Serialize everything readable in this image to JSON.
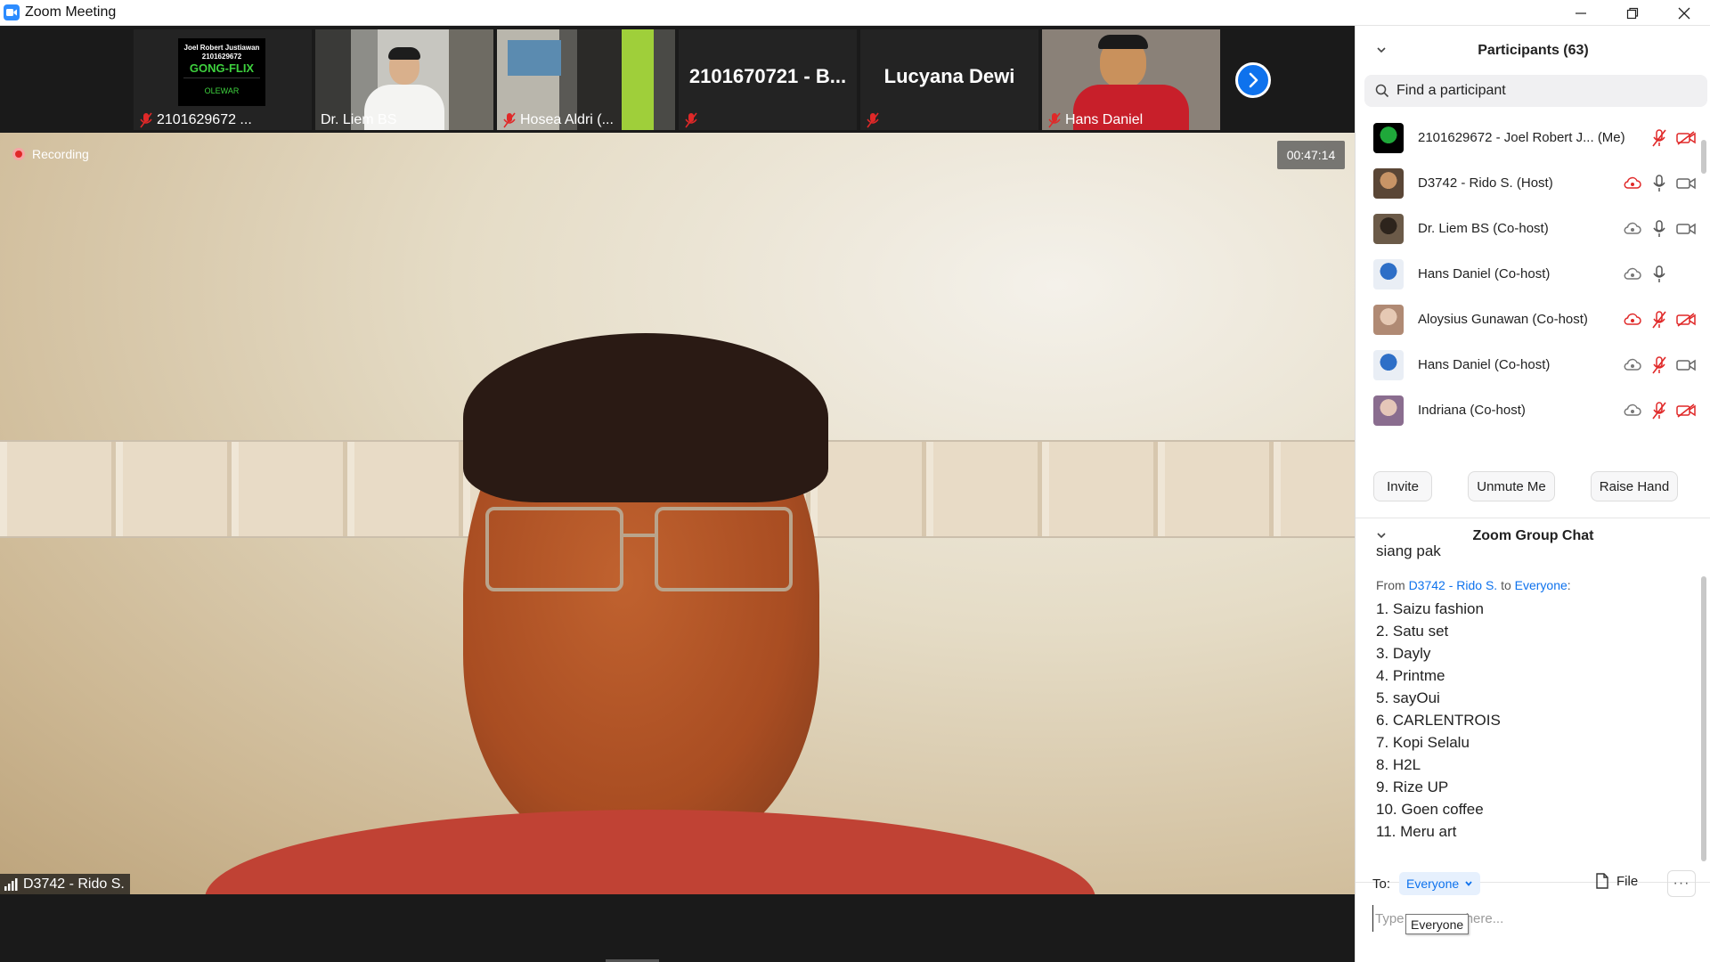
{
  "window": {
    "title": "Zoom Meeting"
  },
  "strip": {
    "tiles": [
      {
        "name": "2101629672 ...",
        "logo_lines": [
          "Joel Robert Justiawan",
          "2101629672",
          "GONG-FLIX",
          "OLEWAR"
        ]
      },
      {
        "name": "Dr. Liem BS"
      },
      {
        "name": "Hosea Aldri (..."
      },
      {
        "name": "2101670721 - B..."
      },
      {
        "name": "Lucyana Dewi"
      },
      {
        "name": "Hans Daniel"
      }
    ]
  },
  "main": {
    "recording_label": "Recording",
    "timer": "00:47:14",
    "speaker": "D3742 - Rido S."
  },
  "participants": {
    "header": "Participants (63)",
    "search_placeholder": "Find a participant",
    "rows": [
      {
        "name": "2101629672 - Joel Robert J...",
        "suffix": "(Me)",
        "rec": false,
        "mic": "muted",
        "video": "off"
      },
      {
        "name": "D3742 - Rido S. (Host)",
        "suffix": "",
        "rec": true,
        "mic": "on",
        "video": "on"
      },
      {
        "name": "Dr. Liem BS (Co-host)",
        "suffix": "",
        "rec": false,
        "mic": "on",
        "video": "on"
      },
      {
        "name": "Hans Daniel (Co-host)",
        "suffix": "",
        "rec": false,
        "mic": "on",
        "video": "none"
      },
      {
        "name": "Aloysius Gunawan (Co-host)",
        "suffix": "",
        "rec": true,
        "mic": "muted",
        "video": "off"
      },
      {
        "name": "Hans Daniel (Co-host)",
        "suffix": "",
        "rec": false,
        "mic": "muted",
        "video": "on"
      },
      {
        "name": "Indriana (Co-host)",
        "suffix": "",
        "rec": false,
        "mic": "muted",
        "video": "off"
      }
    ],
    "buttons": {
      "invite": "Invite",
      "unmute": "Unmute Me",
      "raise_hand": "Raise Hand"
    }
  },
  "chat": {
    "header": "Zoom Group Chat",
    "prev_message": "siang pak",
    "from_prefix": "From",
    "from_sender": "D3742 - Rido S.",
    "from_to": "to",
    "from_recipient": "Everyone",
    "from_suffix": ":",
    "lines": [
      "1. Saizu fashion",
      "2. Satu set",
      "3. Dayly",
      "4. Printme",
      "5. sayOui",
      "6. CARLENTROIS",
      "7. Kopi Selalu",
      "8. H2L",
      "9. Rize UP",
      "10. Goen coffee",
      "11. Meru art"
    ],
    "to_label": "To:",
    "to_value": "Everyone",
    "file_label": "File",
    "more_label": "···",
    "input_placeholder": "Type message here...",
    "tooltip": "Everyone"
  },
  "colors": {
    "accent": "#0e72ed",
    "danger": "#e02828",
    "dark_bg": "#1a1a1a"
  }
}
